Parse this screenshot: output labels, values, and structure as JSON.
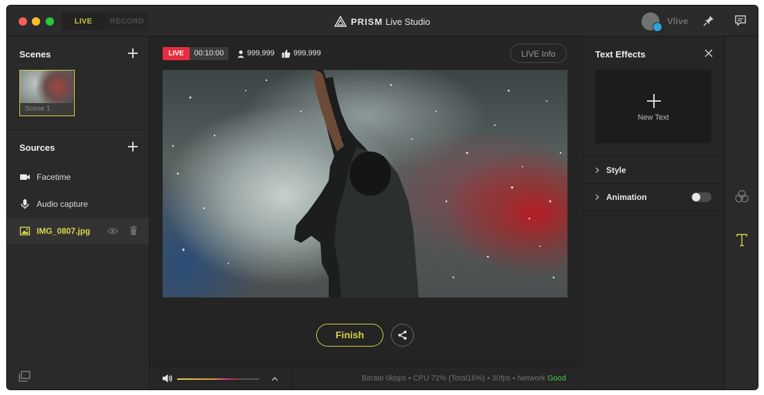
{
  "titlebar": {
    "mode_live": "LIVE",
    "mode_record": "RECORD",
    "app_brand": "PRISM",
    "app_name": "Live Studio",
    "user_name": "Vlive"
  },
  "scenes": {
    "title": "Scenes",
    "items": [
      {
        "label": "Scene 1"
      }
    ]
  },
  "sources": {
    "title": "Sources",
    "items": [
      {
        "label": "Facetime",
        "icon": "camera-icon"
      },
      {
        "label": "Audio capture",
        "icon": "microphone-icon"
      },
      {
        "label": "IMG_0807.jpg",
        "icon": "image-icon",
        "active": true
      }
    ]
  },
  "broadcast": {
    "live_badge": "LIVE",
    "elapsed": "00:10:00",
    "viewers": "999,999",
    "likes": "999,999",
    "live_info_label": "LIVE Info"
  },
  "controls": {
    "finish_label": "Finish",
    "volume_level": 0.76
  },
  "status": {
    "bitrate": "Bitrate 0kbps",
    "cpu": "CPU 72% (Total16%)",
    "fps": "30fps",
    "network_label": "Network",
    "network_value": "Good",
    "separator": "•"
  },
  "text_effects": {
    "title": "Text Effects",
    "new_text_label": "New Text",
    "sections": [
      {
        "label": "Style"
      },
      {
        "label": "Animation",
        "toggle": false
      }
    ]
  },
  "colors": {
    "accent": "#d8d347",
    "live_red": "#e62e40",
    "good_green": "#3ecb48"
  }
}
